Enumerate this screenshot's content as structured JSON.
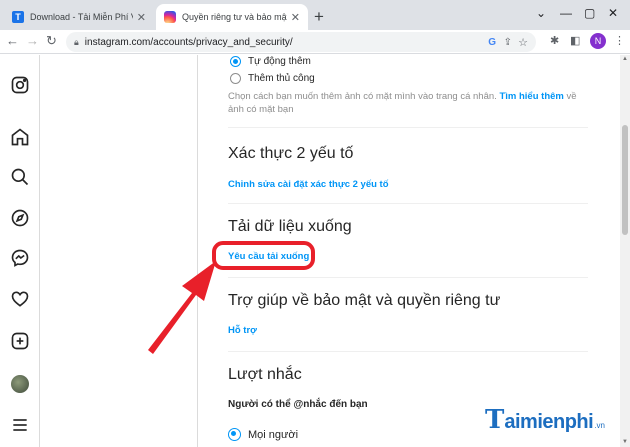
{
  "browser": {
    "tabs": [
      {
        "title": "Download - Tải Miễn Phí VN - Ph",
        "favicon": "T"
      },
      {
        "title": "Quyền riêng tư và bảo mật • Inst",
        "favicon": ""
      }
    ],
    "url": "instagram.com/accounts/privacy_and_security/",
    "profile_initial": "N"
  },
  "ig_nav": [
    "instagram-logo-icon",
    "home-icon",
    "search-icon",
    "explore-icon",
    "messenger-icon",
    "heart-icon",
    "create-icon",
    "profile-avatar",
    "menu-icon"
  ],
  "settings": {
    "photo_options": [
      "Tự động thêm",
      "Thêm thủ công"
    ],
    "photo_desc": "Chọn cách bạn muốn thêm ảnh có mặt mình vào trang cá nhân.",
    "photo_desc_link": "Tìm hiểu thêm",
    "photo_desc_tail": "về ảnh có mặt bạn",
    "two_factor_title": "Xác thực 2 yếu tố",
    "two_factor_link": "Chỉnh sửa cài đặt xác thực 2 yếu tố",
    "download_title": "Tải dữ liệu xuống",
    "download_link": "Yêu cầu tải xuống",
    "help_title": "Trợ giúp về bảo mật và quyền riêng tư",
    "help_link": "Hỗ trợ",
    "mentions_title": "Lượt nhắc",
    "mentions_sub": "Người có thể @nhắc đến bạn",
    "mentions_option": "Mọi người"
  },
  "watermark": {
    "t": "T",
    "text": "aimienphi",
    "tld": ".vn"
  },
  "colors": {
    "accent": "#0095f6",
    "highlight": "#e8202a",
    "brand": "#1d6ec0"
  }
}
